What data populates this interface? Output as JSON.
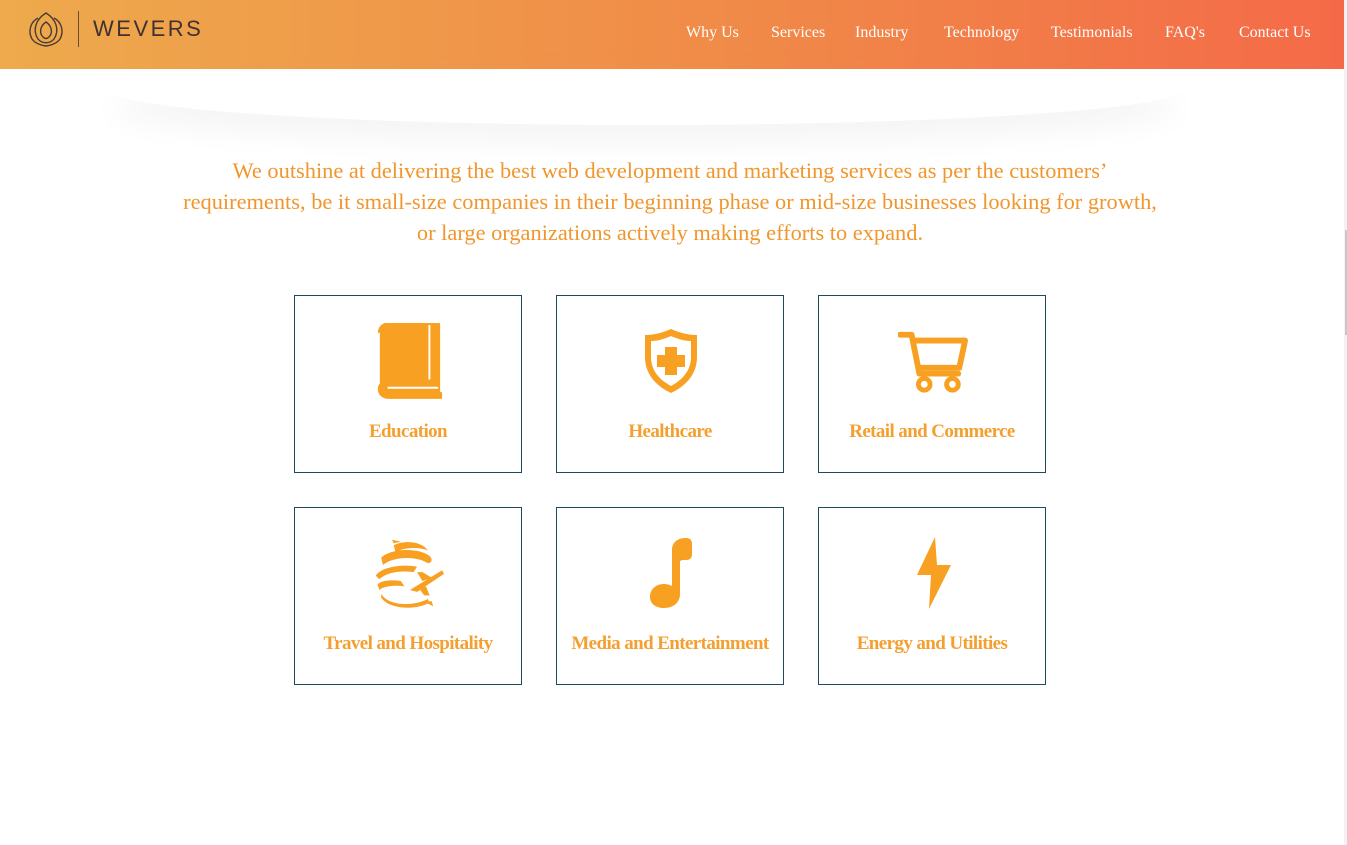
{
  "brand": {
    "name": "WEVERS"
  },
  "nav": [
    {
      "label": "Why Us"
    },
    {
      "label": "Services"
    },
    {
      "label": "Industry"
    },
    {
      "label": "Technology"
    },
    {
      "label": "Testimonials"
    },
    {
      "label": "FAQ's"
    },
    {
      "label": "Contact Us"
    }
  ],
  "intro": {
    "lines": [
      "We outshine at delivering the best web development and marketing services as per the customers’",
      "requirements, be it small-size companies in their beginning phase or mid-size businesses looking for growth,",
      "or large organizations actively making efforts to expand."
    ]
  },
  "industries": [
    {
      "label": "Education",
      "icon": "book-icon"
    },
    {
      "label": "Healthcare",
      "icon": "medical-shield-icon"
    },
    {
      "label": "Retail and Commerce",
      "icon": "shopping-cart-icon"
    },
    {
      "label": "Travel and Hospitality",
      "icon": "globe-airplane-icon"
    },
    {
      "label": "Media and Entertainment",
      "icon": "music-note-icon"
    },
    {
      "label": "Energy and Utilities",
      "icon": "lightning-bolt-icon"
    }
  ],
  "colors": {
    "accent": "#f4a030",
    "intro_text": "#f0962c",
    "card_border": "#1c4a5a",
    "header_start": "#eeaa4c",
    "header_end": "#f46a48"
  }
}
